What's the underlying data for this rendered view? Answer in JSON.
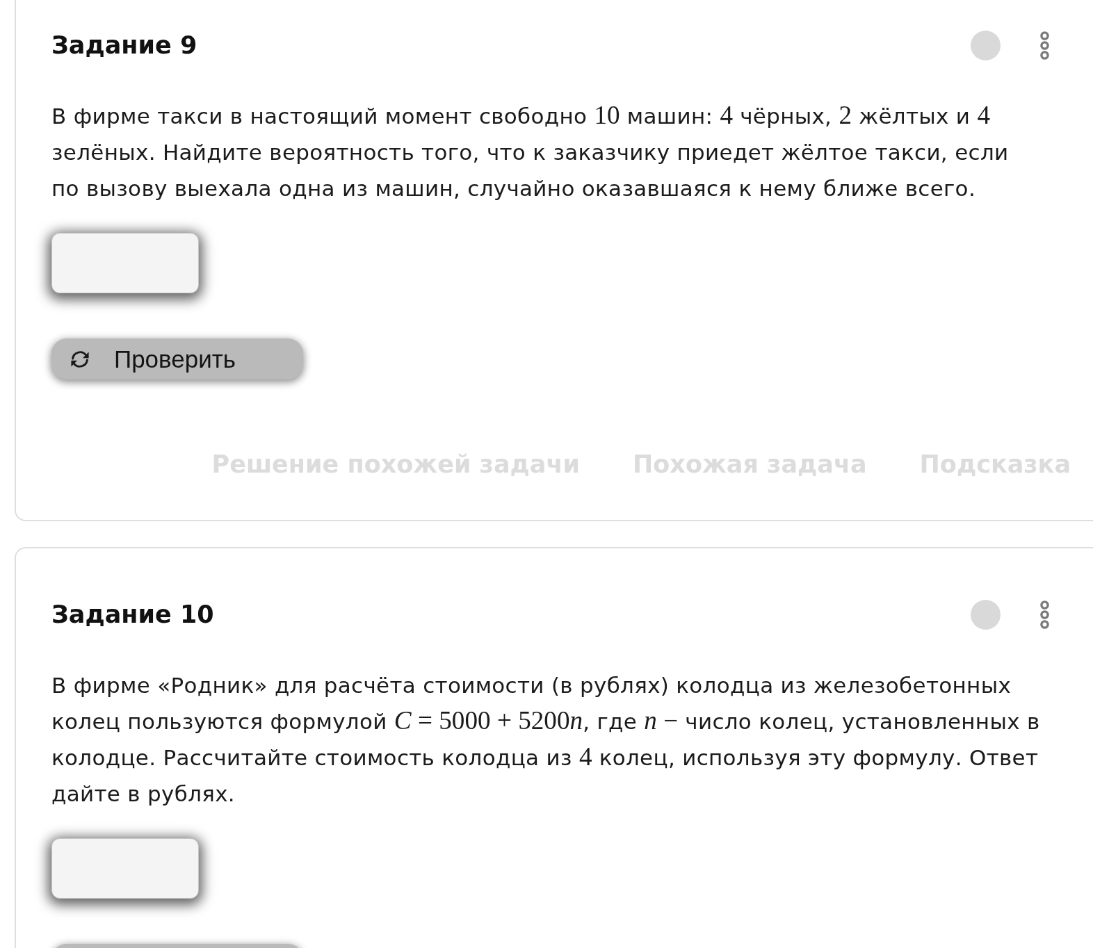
{
  "tasks": [
    {
      "title": "Задание 9",
      "text": [
        {
          "kind": "text",
          "text": "В фирме такси в настоящий момент свободно "
        },
        {
          "kind": "math",
          "text": "10"
        },
        {
          "kind": "text",
          "text": " машин: "
        },
        {
          "kind": "math",
          "text": "4"
        },
        {
          "kind": "text",
          "text": " чёрных, "
        },
        {
          "kind": "math",
          "text": "2"
        },
        {
          "kind": "text",
          "text": " жёлтых и "
        },
        {
          "kind": "math",
          "text": "4"
        },
        {
          "kind": "text",
          "text": " зелёных. Найдите вероятность того, что к заказчику приедет жёлтое такси, если по вызову выехала одна из машин, случайно оказавшаяся к нему ближе всего."
        }
      ],
      "answer_field": {
        "kind": "input"
      },
      "check_button": {
        "kind": "full",
        "label": "Проверить"
      },
      "links": [
        {
          "label": "Решение похожей задачи"
        },
        {
          "label": "Похожая задача"
        },
        {
          "label": "Подсказка"
        }
      ]
    },
    {
      "title": "Задание 10",
      "text": [
        {
          "kind": "text",
          "text": "В фирме «Родник» для расчёта стоимости (в рублях) колодца из железобетонных колец пользуются формулой "
        },
        {
          "kind": "math",
          "text": "*C* = 5000 + 5200"
        },
        {
          "kind": "math",
          "text": "*n*"
        },
        {
          "kind": "text",
          "text": ", где "
        },
        {
          "kind": "math",
          "text": "*n* −"
        },
        {
          "kind": "text",
          "text": " число колец, установленных в колодце. Рассчитайте стоимость колодца из "
        },
        {
          "kind": "math",
          "text": "4"
        },
        {
          "kind": "text",
          "text": " колец, используя эту формулу. Ответ дайте в рублях."
        }
      ],
      "answer_field": {
        "kind": "input"
      },
      "check_button": {
        "kind": "cut_off"
      }
    }
  ]
}
